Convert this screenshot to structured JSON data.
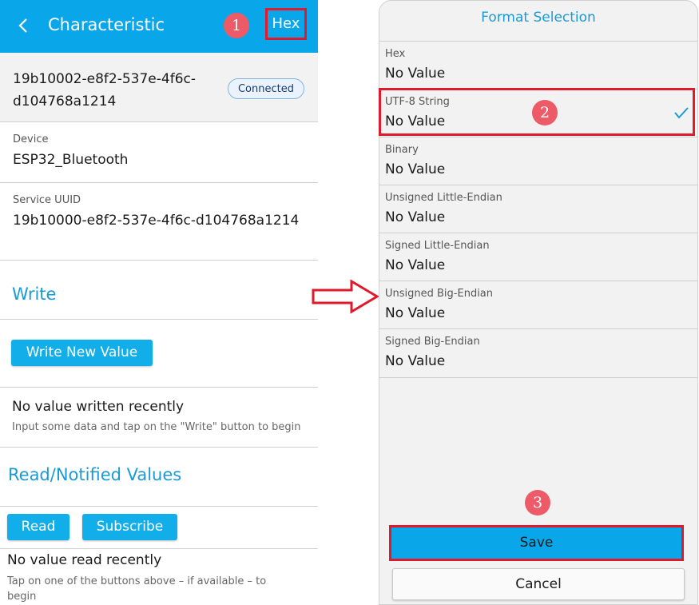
{
  "left": {
    "appbar": {
      "title": "Characteristic",
      "format_button": "Hex"
    },
    "callout1": "1",
    "characteristic_uuid": "19b10002-e8f2-537e-4f6c-d104768a1214",
    "status_badge": "Connected",
    "device": {
      "label": "Device",
      "value": "ESP32_Bluetooth"
    },
    "service": {
      "label": "Service UUID",
      "value": "19b10000-e8f2-537e-4f6c-d104768a1214"
    },
    "write": {
      "title": "Write",
      "button": "Write New Value",
      "status": "No value written recently",
      "hint": "Input some data and tap on the \"Write\" button to begin"
    },
    "read": {
      "title": "Read/Notified Values",
      "read_button": "Read",
      "subscribe_button": "Subscribe",
      "status": "No value read recently",
      "hint": "Tap on one of the buttons above – if available – to begin"
    }
  },
  "right": {
    "title": "Format Selection",
    "callout2": "2",
    "callout3": "3",
    "formats": [
      {
        "label": "Hex",
        "value": "No Value",
        "selected": false
      },
      {
        "label": "UTF-8 String",
        "value": "No Value",
        "selected": true
      },
      {
        "label": "Binary",
        "value": "No Value",
        "selected": false
      },
      {
        "label": "Unsigned Little-Endian",
        "value": "No Value",
        "selected": false
      },
      {
        "label": "Signed Little-Endian",
        "value": "No Value",
        "selected": false
      },
      {
        "label": "Unsigned Big-Endian",
        "value": "No Value",
        "selected": false
      },
      {
        "label": "Signed Big-Endian",
        "value": "No Value",
        "selected": false
      }
    ],
    "save_button": "Save",
    "cancel_button": "Cancel"
  },
  "colors": {
    "accent": "#0aa6ea",
    "section_title": "#1a9ad6",
    "highlight_border": "#e0192b",
    "callout": "#ec5b67"
  }
}
